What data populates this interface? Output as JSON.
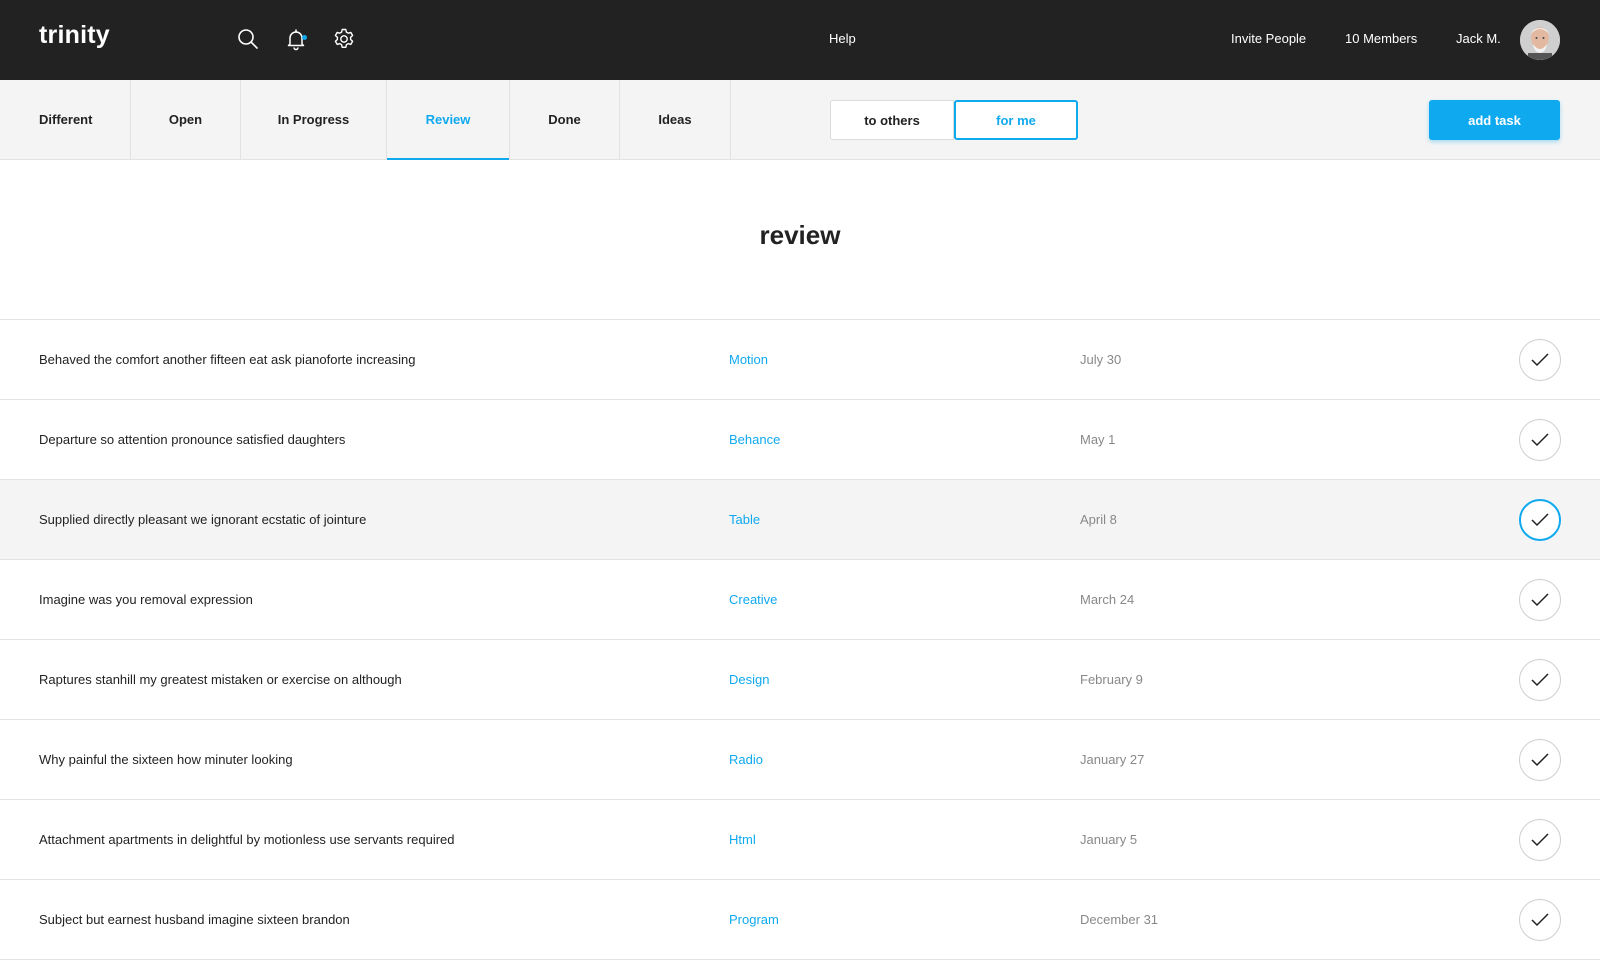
{
  "app": {
    "logo": "trinity"
  },
  "topbar": {
    "help": "Help",
    "invite": "Invite People",
    "members": "10 Members",
    "user": "Jack M.",
    "icons": [
      "search-icon",
      "bell-icon",
      "gear-icon"
    ]
  },
  "tabs": [
    {
      "label": "Different",
      "active": false
    },
    {
      "label": "Open",
      "active": false
    },
    {
      "label": "In Progress",
      "active": false
    },
    {
      "label": "Review",
      "active": true
    },
    {
      "label": "Done",
      "active": false
    },
    {
      "label": "Ideas",
      "active": false
    }
  ],
  "filter": {
    "to_others": "to others",
    "for_me": "for me",
    "selected": "for me"
  },
  "add_task": "add task",
  "page_title": "review",
  "colors": {
    "accent": "#0fa9f0",
    "topbar": "#222222",
    "muted": "#888888"
  },
  "tasks": [
    {
      "title": "Behaved the comfort another fifteen eat ask pianoforte increasing",
      "tag": "Motion",
      "date": "July 30"
    },
    {
      "title": "Departure so attention pronounce satisfied daughters",
      "tag": "Behance",
      "date": "May 1"
    },
    {
      "title": "Supplied directly pleasant we ignorant ecstatic of jointure",
      "tag": "Table",
      "date": "April 8"
    },
    {
      "title": "Imagine was you removal expression",
      "tag": "Creative",
      "date": "March 24"
    },
    {
      "title": "Raptures stanhill my greatest mistaken or exercise on although",
      "tag": "Design",
      "date": "February 9"
    },
    {
      "title": "Why painful the sixteen how minuter looking",
      "tag": "Radio",
      "date": "January 27"
    },
    {
      "title": "Attachment apartments in delightful by motionless use servants required",
      "tag": "Html",
      "date": "January 5"
    },
    {
      "title": "Subject but earnest husband imagine sixteen brandon",
      "tag": "Program",
      "date": "December 31"
    }
  ]
}
